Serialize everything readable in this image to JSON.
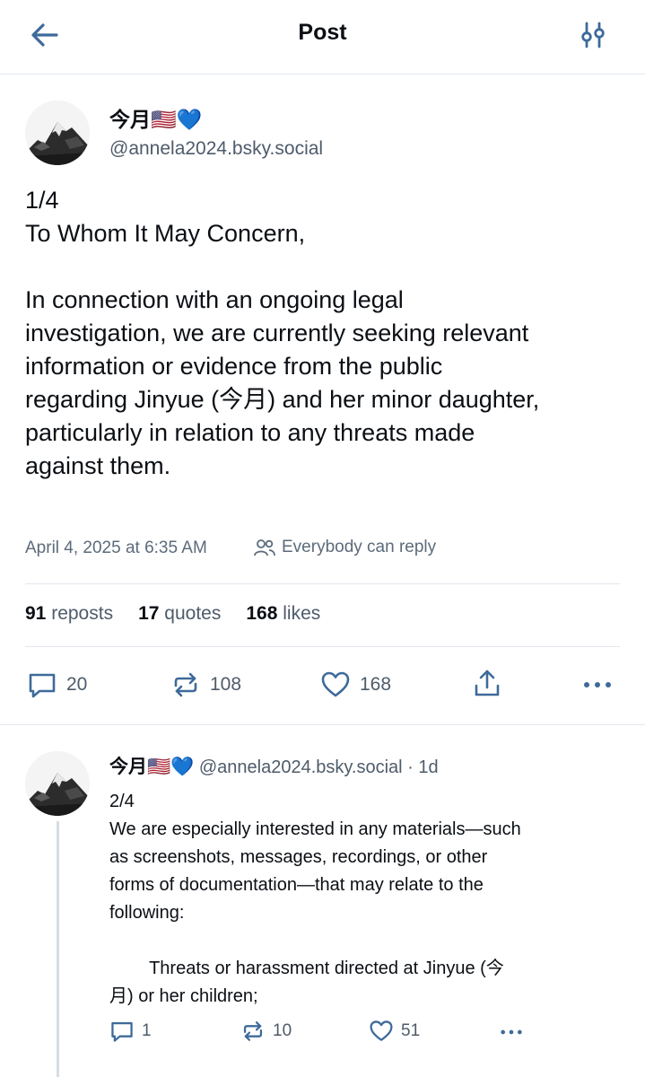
{
  "header": {
    "title": "Post"
  },
  "post": {
    "author_name": "今月🇺🇸💙",
    "handle": "@annela2024.bsky.social",
    "lines": [
      "1/4",
      "To Whom It May Concern,",
      "",
      "In connection with an ongoing legal",
      "investigation, we are currently seeking relevant",
      "information or evidence from the public",
      "regarding Jinyue (今月) and her minor daughter,",
      "particularly in relation to any threats made",
      "against them."
    ],
    "timestamp": "April 4, 2025 at 6:35 AM",
    "reply_setting": "Everybody can reply",
    "stats": {
      "reposts_count": "91",
      "reposts_label": "reposts",
      "quotes_count": "17",
      "quotes_label": "quotes",
      "likes_count": "168",
      "likes_label": "likes"
    },
    "actions": {
      "replies": "20",
      "reposts": "108",
      "likes": "168"
    }
  },
  "reply": {
    "author_name": "今月🇺🇸💙",
    "handle": "@annela2024.bsky.social",
    "time": "· 1d",
    "lines": [
      "2/4",
      "We are especially interested in any materials—such",
      "as screenshots, messages, recordings, or other",
      "forms of documentation—that may relate to the",
      "following:",
      "",
      "        Threats or harassment directed at Jinyue (今",
      "月) or her children;"
    ],
    "actions": {
      "replies": "1",
      "reposts": "10",
      "likes": "51"
    }
  },
  "colors": {
    "text": "#0b0f14",
    "muted": "#4e5b6a",
    "divider": "#e3e8ee",
    "accent": "#1083fe"
  },
  "icons": [
    "back-arrow-icon",
    "filter-sliders-icon",
    "reply-icon",
    "repost-icon",
    "like-icon",
    "share-icon",
    "more-icon",
    "people-icon"
  ]
}
